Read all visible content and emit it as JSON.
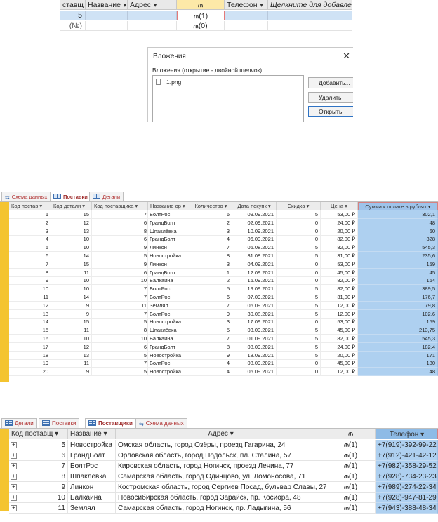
{
  "top_table": {
    "columns": [
      {
        "label": "ставщ",
        "dropdown": "▾"
      },
      {
        "label": "Название",
        "dropdown": "▾"
      },
      {
        "label": "Адрес",
        "dropdown": "▾"
      },
      {
        "label": "",
        "icon": "paperclip-icon",
        "glyph": "⫙"
      },
      {
        "label": "Телефон",
        "dropdown": "▾"
      },
      {
        "label": "Щелкните для добавлени",
        "dropdown": ""
      }
    ],
    "row_selected": {
      "code": "5",
      "attach": "(1)"
    },
    "row_new": {
      "code": "(№)",
      "attach": "(0)"
    }
  },
  "attach_dialog": {
    "title": "Вложения",
    "close_glyph": "✕",
    "caption": "Вложения (открытие - двойной щелчок)",
    "file": "1.png",
    "buttons": {
      "add": "Добавить...",
      "remove": "Удалить",
      "open": "Открыть"
    }
  },
  "tabs1": {
    "schema": "Схема данных",
    "postavki": "Поставки",
    "detali": "Детали"
  },
  "deliveries": {
    "headers": [
      "Код постав ▾",
      "Код детали ▾",
      "Код поставщика ▾",
      "Название ор ▾",
      "Количество ▾",
      "Дата покупк ▾",
      "Скидка ▾",
      "Цена ▾",
      "Сумма к оплате в рублях ▾"
    ],
    "rows": [
      [
        "1",
        "15",
        "7 БолтРос",
        "6",
        "09.09.2021",
        "5",
        "53,00 ₽",
        "302,1"
      ],
      [
        "2",
        "12",
        "6 ГрандБолт",
        "2",
        "02.09.2021",
        "0",
        "24,00 ₽",
        "48"
      ],
      [
        "3",
        "13",
        "8 Шпаклёвка",
        "3",
        "10.09.2021",
        "0",
        "20,00 ₽",
        "60"
      ],
      [
        "4",
        "10",
        "6 ГрандБолт",
        "4",
        "06.09.2021",
        "0",
        "82,00 ₽",
        "328"
      ],
      [
        "5",
        "10",
        "9 Линкон",
        "7",
        "06.08.2021",
        "5",
        "82,00 ₽",
        "545,3"
      ],
      [
        "6",
        "14",
        "5 Новостройка",
        "8",
        "31.08.2021",
        "5",
        "31,00 ₽",
        "235,6"
      ],
      [
        "7",
        "15",
        "9 Линкон",
        "3",
        "04.09.2021",
        "0",
        "53,00 ₽",
        "159"
      ],
      [
        "8",
        "11",
        "6 ГрандБолт",
        "1",
        "12.09.2021",
        "0",
        "45,00 ₽",
        "45"
      ],
      [
        "9",
        "10",
        "10 Балкаина",
        "2",
        "16.09.2021",
        "0",
        "82,00 ₽",
        "164"
      ],
      [
        "10",
        "10",
        "7 БолтРос",
        "5",
        "19.09.2021",
        "5",
        "82,00 ₽",
        "389,5"
      ],
      [
        "11",
        "14",
        "7 БолтРос",
        "6",
        "07.09.2021",
        "5",
        "31,00 ₽",
        "176,7"
      ],
      [
        "12",
        "9",
        "11 Землял",
        "7",
        "06.09.2021",
        "5",
        "12,00 ₽",
        "79,8"
      ],
      [
        "13",
        "9",
        "7 БолтРос",
        "9",
        "30.08.2021",
        "5",
        "12,00 ₽",
        "102,6"
      ],
      [
        "14",
        "15",
        "5 Новостройка",
        "3",
        "17.09.2021",
        "0",
        "53,00 ₽",
        "159"
      ],
      [
        "15",
        "11",
        "8 Шпаклёвка",
        "5",
        "03.09.2021",
        "5",
        "45,00 ₽",
        "213,75"
      ],
      [
        "16",
        "10",
        "10 Балкаина",
        "7",
        "01.09.2021",
        "5",
        "82,00 ₽",
        "545,3"
      ],
      [
        "17",
        "12",
        "6 ГрандБолт",
        "8",
        "08.09.2021",
        "5",
        "24,00 ₽",
        "182,4"
      ],
      [
        "18",
        "13",
        "5 Новостройка",
        "9",
        "18.09.2021",
        "5",
        "20,00 ₽",
        "171"
      ],
      [
        "19",
        "11",
        "7 БолтРос",
        "4",
        "08.09.2021",
        "0",
        "45,00 ₽",
        "180"
      ],
      [
        "20",
        "9",
        "5 Новостройка",
        "4",
        "06.09.2021",
        "0",
        "12,00 ₽",
        "48"
      ]
    ]
  },
  "tabs2": {
    "detali": "Детали",
    "postavki": "Поставки",
    "postavshiki": "Поставщики",
    "schema": "Схема данных"
  },
  "suppliers": {
    "headers": [
      "Код поставщ ▾",
      "Название ▾",
      "Адрес ▾",
      "",
      "Телефон ▾"
    ],
    "attach_glyph": "⫙",
    "rows": [
      [
        "5",
        "Новостройка",
        "Омская область, город Озёры, проезд Гагарина, 24",
        "(1)",
        "+7(919)-392-99-22"
      ],
      [
        "6",
        "ГрандБолт",
        "Орловская область, город Подольск, пл. Сталина, 57",
        "(1)",
        "+7(912)-421-42-12"
      ],
      [
        "7",
        "БолтРос",
        "Кировская область, город Ногинск, проезд Ленина, 77",
        "(1)",
        "+7(982)-358-29-52"
      ],
      [
        "8",
        "Шпаклёвка",
        "Самарская область, город Одинцово, ул. Ломоносова, 71",
        "(1)",
        "+7(928)-734-23-23"
      ],
      [
        "9",
        "Линкон",
        "Костромская область, город Сергиев Посад, бульвар Славы, 27",
        "(1)",
        "+7(989)-274-22-34"
      ],
      [
        "10",
        "Балкаина",
        "Новосибирская область, город Зарайск, пр. Косиора, 48",
        "(1)",
        "+7(928)-947-81-29"
      ],
      [
        "11",
        "Землял",
        "Самарская область, город Ногинск, пр. Ладыгина, 56",
        "(1)",
        "+7(943)-388-48-34"
      ]
    ]
  }
}
